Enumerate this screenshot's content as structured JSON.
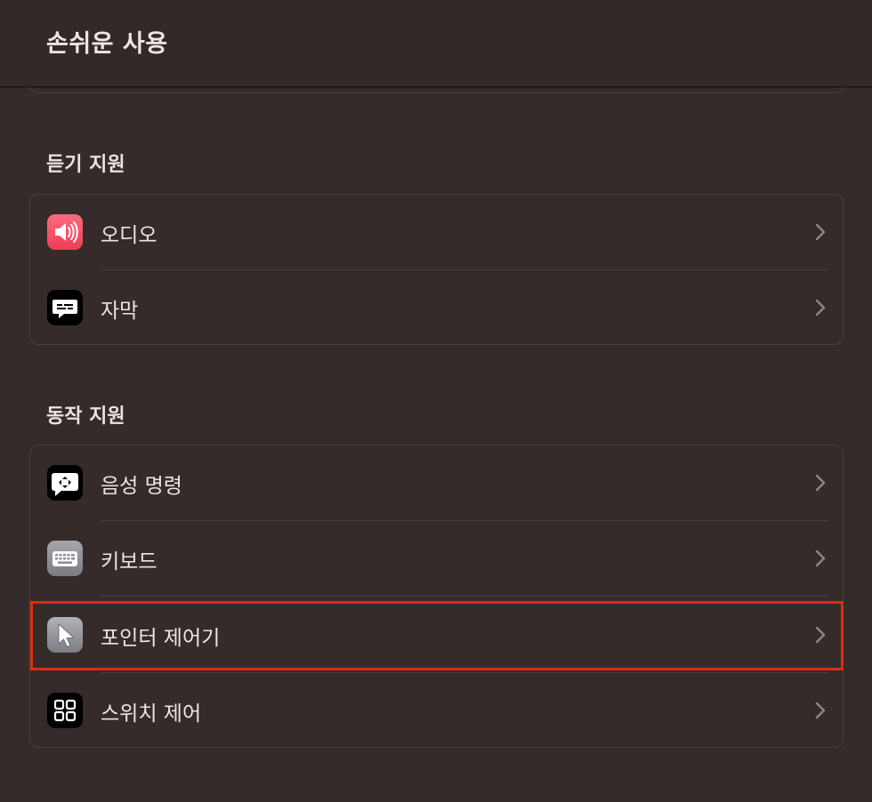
{
  "header": {
    "title": "손쉬운 사용"
  },
  "sections": [
    {
      "title": "듣기 지원",
      "items": [
        {
          "label": "오디오",
          "icon": "speaker-icon",
          "color": "#f0475e"
        },
        {
          "label": "자막",
          "icon": "captions-bubble-icon",
          "color": "#000000"
        }
      ]
    },
    {
      "title": "동작 지원",
      "items": [
        {
          "label": "음성 명령",
          "icon": "voice-control-icon",
          "color": "#000000"
        },
        {
          "label": "키보드",
          "icon": "keyboard-icon",
          "color": "#8e8e93"
        },
        {
          "label": "포인터 제어기",
          "icon": "pointer-icon",
          "color": "#8e8e93"
        },
        {
          "label": "스위치 제어",
          "icon": "switch-control-icon",
          "color": "#000000"
        }
      ]
    }
  ],
  "highlight": {
    "target": "포인터 제어기",
    "color": "#e02a14"
  }
}
